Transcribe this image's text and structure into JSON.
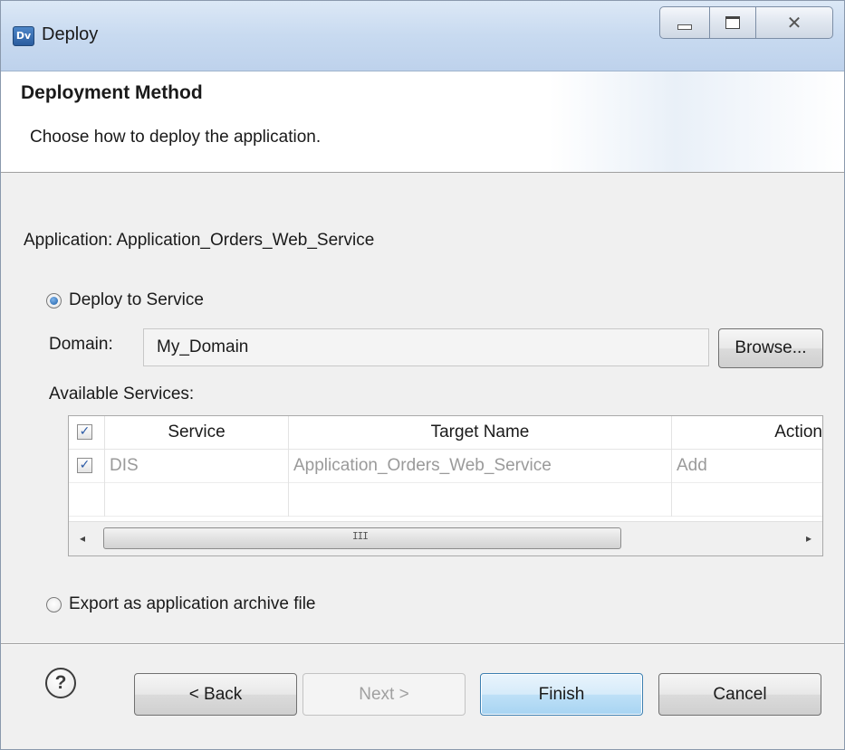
{
  "window": {
    "icon_text": "Dv",
    "title": "Deploy"
  },
  "banner": {
    "title": "Deployment Method",
    "description": "Choose how to deploy the application."
  },
  "application_label": "Application: Application_Orders_Web_Service",
  "deploy_option": {
    "label": "Deploy to Service",
    "selected": true
  },
  "domain": {
    "label": "Domain:",
    "value": "My_Domain",
    "browse_label": "Browse..."
  },
  "services": {
    "label": "Available Services:",
    "columns": [
      "Service",
      "Target Name",
      "Action"
    ],
    "header_checked": true,
    "rows": [
      {
        "checked": true,
        "service": "DIS",
        "target_name": "Application_Orders_Web_Service",
        "action": "Add"
      }
    ],
    "scrollbar_grip": "III"
  },
  "export_option": {
    "label": "Export as application archive file",
    "selected": false
  },
  "footer": {
    "help_glyph": "?",
    "back_label": "< Back",
    "next_label": "Next >",
    "finish_label": "Finish",
    "cancel_label": "Cancel"
  },
  "icons": {
    "app": "dv-app-icon",
    "minimize": "minimize-icon",
    "maximize": "maximize-icon",
    "close": "close-icon",
    "help": "help-icon",
    "checkbox_mark": "✓",
    "scroll_left": "◂",
    "scroll_right": "▸"
  }
}
